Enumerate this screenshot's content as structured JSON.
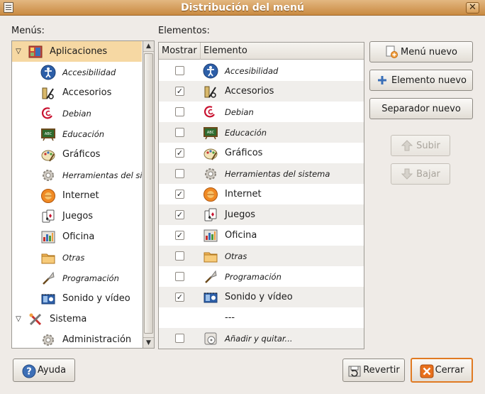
{
  "window": {
    "title": "Distribución del menú",
    "close_glyph": "✕"
  },
  "menus_label": "Menús:",
  "elements_label": "Elementos:",
  "tree": {
    "items": [
      {
        "label": "Aplicaciones",
        "level": 0,
        "expanded": true,
        "selected": true,
        "italic": false,
        "icon": "applications-icon"
      },
      {
        "label": "Accesibilidad",
        "level": 1,
        "italic": true,
        "icon": "accessibility-icon"
      },
      {
        "label": "Accesorios",
        "level": 1,
        "italic": false,
        "icon": "accessories-icon"
      },
      {
        "label": "Debian",
        "level": 1,
        "italic": true,
        "icon": "debian-icon"
      },
      {
        "label": "Educación",
        "level": 1,
        "italic": true,
        "icon": "education-icon"
      },
      {
        "label": "Gráficos",
        "level": 1,
        "italic": false,
        "icon": "graphics-icon"
      },
      {
        "label": "Herramientas del sistema",
        "level": 1,
        "italic": true,
        "icon": "system-tools-icon"
      },
      {
        "label": "Internet",
        "level": 1,
        "italic": false,
        "icon": "internet-icon"
      },
      {
        "label": "Juegos",
        "level": 1,
        "italic": false,
        "icon": "games-icon"
      },
      {
        "label": "Oficina",
        "level": 1,
        "italic": false,
        "icon": "office-icon"
      },
      {
        "label": "Otras",
        "level": 1,
        "italic": true,
        "icon": "folder-icon"
      },
      {
        "label": "Programación",
        "level": 1,
        "italic": true,
        "icon": "programming-icon"
      },
      {
        "label": "Sonido y vídeo",
        "level": 1,
        "italic": false,
        "icon": "multimedia-icon"
      },
      {
        "label": "Sistema",
        "level": 0,
        "expanded": true,
        "italic": false,
        "icon": "system-icon"
      },
      {
        "label": "Administración",
        "level": 1,
        "italic": false,
        "icon": "administration-icon"
      }
    ]
  },
  "table": {
    "col_show": "Mostrar",
    "col_element": "Elemento",
    "rows": [
      {
        "label": "Accesibilidad",
        "checked": false,
        "italic": true,
        "icon": "accessibility-icon"
      },
      {
        "label": "Accesorios",
        "checked": true,
        "italic": false,
        "icon": "accessories-icon"
      },
      {
        "label": "Debian",
        "checked": false,
        "italic": true,
        "icon": "debian-icon"
      },
      {
        "label": "Educación",
        "checked": false,
        "italic": true,
        "icon": "education-icon"
      },
      {
        "label": "Gráficos",
        "checked": true,
        "italic": false,
        "icon": "graphics-icon"
      },
      {
        "label": "Herramientas del sistema",
        "checked": false,
        "italic": true,
        "icon": "system-tools-icon"
      },
      {
        "label": "Internet",
        "checked": true,
        "italic": false,
        "icon": "internet-icon"
      },
      {
        "label": "Juegos",
        "checked": true,
        "italic": false,
        "icon": "games-icon"
      },
      {
        "label": "Oficina",
        "checked": true,
        "italic": false,
        "icon": "office-icon"
      },
      {
        "label": "Otras",
        "checked": false,
        "italic": true,
        "icon": "folder-icon"
      },
      {
        "label": "Programación",
        "checked": false,
        "italic": true,
        "icon": "programming-icon"
      },
      {
        "label": "Sonido y vídeo",
        "checked": true,
        "italic": false,
        "icon": "multimedia-icon"
      },
      {
        "label": "---",
        "separator": true
      },
      {
        "label": "Añadir y quitar...",
        "checked": false,
        "italic": true,
        "icon": "add-remove-icon"
      }
    ]
  },
  "buttons": {
    "new_menu": "Menú nuevo",
    "new_item": "Elemento nuevo",
    "new_separator": "Separador nuevo",
    "move_up": "Subir",
    "move_down": "Bajar",
    "help": "Ayuda",
    "revert": "Revertir",
    "close": "Cerrar"
  },
  "colors": {
    "selection": "#f6d8a3",
    "titlebar": "#c98a41",
    "focus": "#e07a22"
  }
}
